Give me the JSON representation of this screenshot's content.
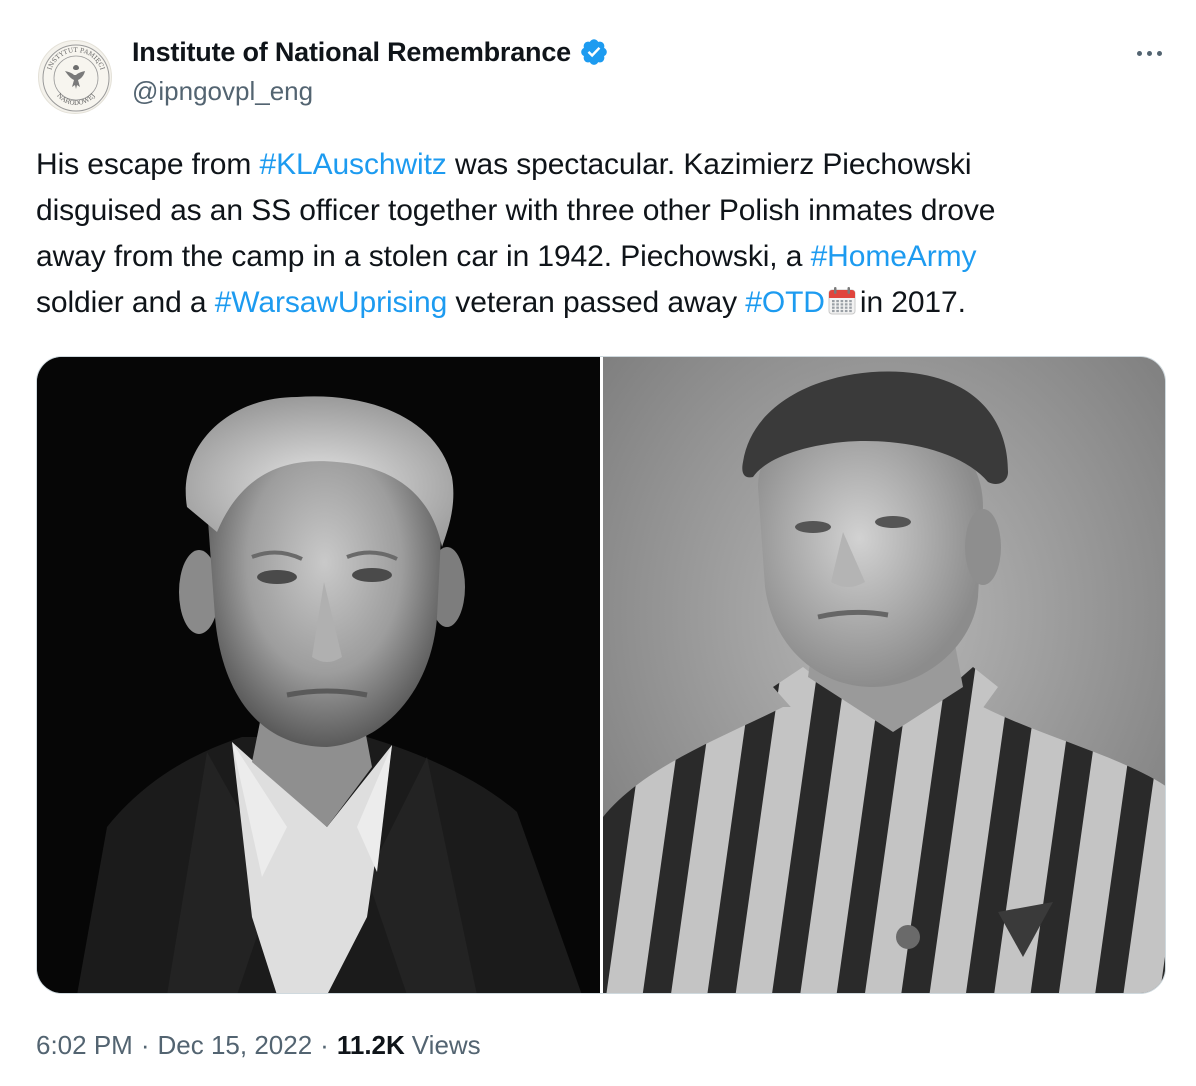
{
  "author": {
    "display_name": "Institute of National Remembrance",
    "handle": "@ipngovpl_eng",
    "verified": true,
    "avatar_icon": "ipn-seal-logo",
    "avatar_seal_text_top": "INSTYTUT PAMIĘCI",
    "avatar_seal_text_bottom": "NARODOWEJ"
  },
  "more_icon": "more-horizontal-icon",
  "tweet": {
    "lines": [
      [
        {
          "t": "His escape from ",
          "tag": false
        },
        {
          "t": "#KLAuschwitz",
          "tag": true
        },
        {
          "t": " was spectacular. Kazimierz Piechowski",
          "tag": false
        }
      ],
      [
        {
          "t": "disguised as an SS officer together with three other Polish inmates drove",
          "tag": false
        }
      ],
      [
        {
          "t": "away from the camp in a stolen car in 1942. Piechowski, a ",
          "tag": false
        },
        {
          "t": "#HomeArmy",
          "tag": true
        }
      ],
      [
        {
          "t": "soldier and a ",
          "tag": false
        },
        {
          "t": "#WarsawUprising",
          "tag": true
        },
        {
          "t": " veteran passed away ",
          "tag": false
        },
        {
          "t": "#OTD",
          "tag": true
        },
        {
          "emoji": "calendar-icon"
        },
        {
          "t": "in 2017.",
          "tag": false
        }
      ]
    ]
  },
  "media": {
    "left_photo": "portrait-elderly-man-photo",
    "right_photo": "prisoner-striped-uniform-photo"
  },
  "meta": {
    "time": "6:02 PM",
    "separator": "·",
    "date": "Dec 15, 2022",
    "views_count": "11.2K",
    "views_label": "Views"
  },
  "colors": {
    "link": "#1d9bf0",
    "text": "#0f1419",
    "secondary": "#536471",
    "verified": "#1d9bf0"
  }
}
